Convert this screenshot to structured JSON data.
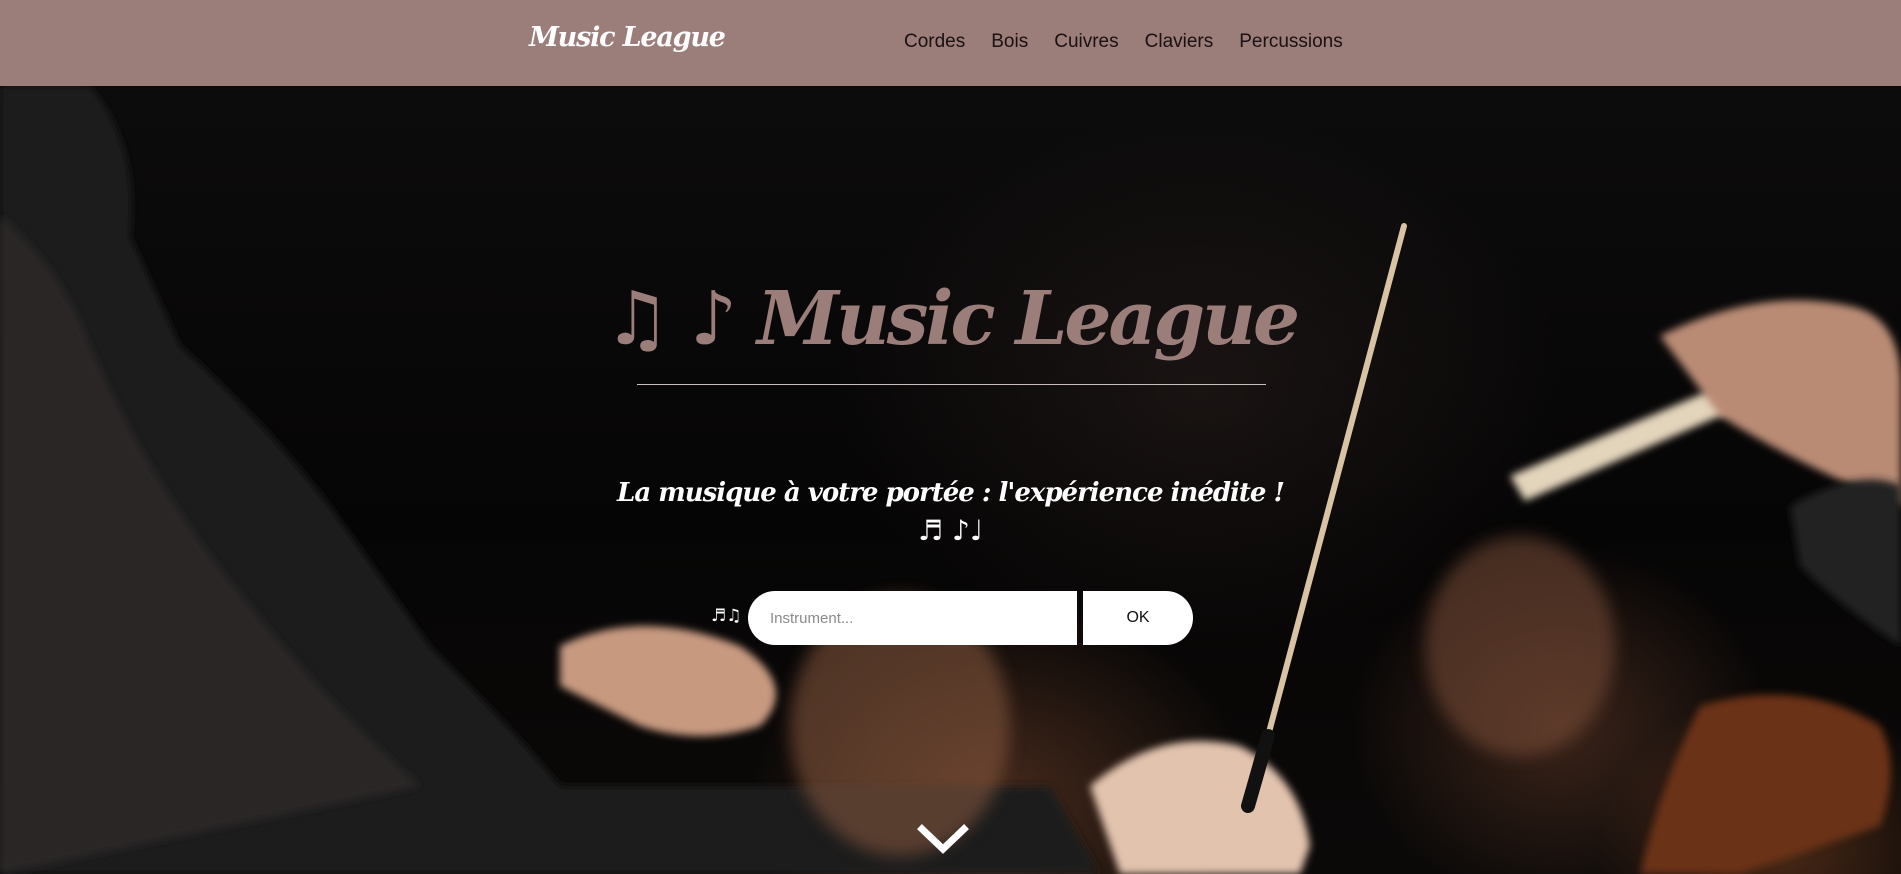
{
  "navbar": {
    "brand": "Music League",
    "links": [
      "Cordes",
      "Bois",
      "Cuivres",
      "Claviers",
      "Percussions"
    ]
  },
  "hero": {
    "title": "♫ ♪ Music League",
    "tagline": "La musique à votre portée : l'expérience inédite !",
    "notes": "♬ ♪♩"
  },
  "search": {
    "notes": "♬♫",
    "placeholder": "Instrument...",
    "value": "",
    "button_label": "OK"
  },
  "icons": {
    "scroll_down": "chevron-down-icon"
  },
  "colors": {
    "navbar_bg": "#9b7d7a",
    "brand_text": "#ffffff",
    "title_text": "#9b7d7a",
    "nav_text": "#1a1112"
  }
}
